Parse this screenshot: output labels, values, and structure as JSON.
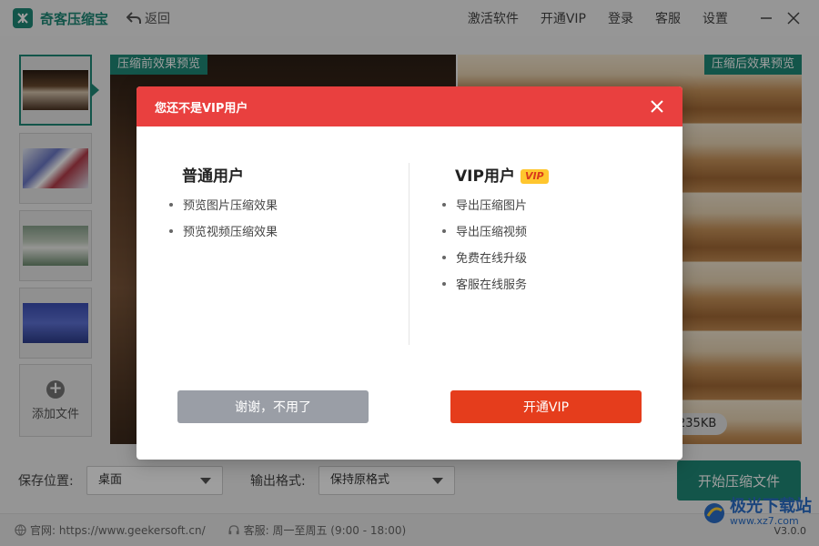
{
  "app": {
    "name": "奇客压缩宝",
    "back_label": "返回"
  },
  "menu": {
    "items": [
      "激活软件",
      "开通VIP",
      "登录",
      "客服",
      "设置"
    ]
  },
  "preview": {
    "before_label": "压缩前效果预览",
    "after_label": "压缩后效果预览",
    "size_after": "235KB"
  },
  "sidebar": {
    "add_file_label": "添加文件"
  },
  "controls": {
    "save_label": "保存位置:",
    "save_value": "桌面",
    "format_label": "输出格式:",
    "format_value": "保持原格式",
    "start_label": "开始压缩文件"
  },
  "status": {
    "website": "官网: https://www.geekersoft.cn/",
    "service": "客服: 周一至周五 (9:00 - 18:00)",
    "version": "V3.0.0"
  },
  "watermark": {
    "title": "极光下载站",
    "url": "www.xz7.com"
  },
  "modal": {
    "title": "您还不是VIP用户",
    "normal": {
      "title": "普通用户",
      "features": [
        "预览图片压缩效果",
        "预览视频压缩效果"
      ]
    },
    "vip": {
      "title": "VIP用户",
      "badge": "VIP",
      "features": [
        "导出压缩图片",
        "导出压缩视频",
        "免费在线升级",
        "客服在线服务"
      ]
    },
    "decline_label": "谢谢，不用了",
    "confirm_label": "开通VIP"
  },
  "colors": {
    "brand": "#1f8a78",
    "modal_header": "#e9403f",
    "vip_button": "#e53d1c"
  }
}
